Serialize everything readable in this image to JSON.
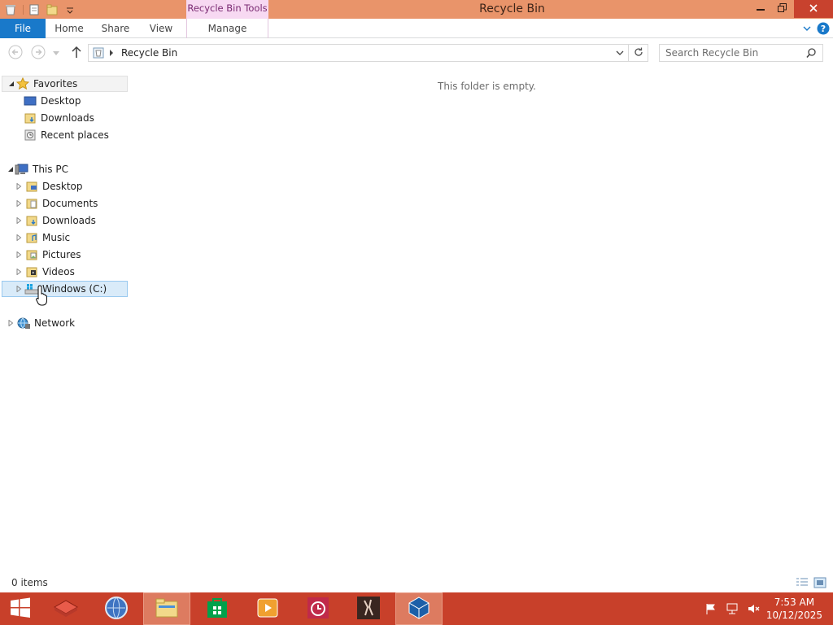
{
  "window": {
    "title": "Recycle Bin",
    "context_tab_group": "Recycle Bin Tools"
  },
  "ribbon": {
    "tabs": [
      "File",
      "Home",
      "Share",
      "View",
      "Manage"
    ]
  },
  "address": {
    "path": "Recycle Bin"
  },
  "search": {
    "placeholder": "Search Recycle Bin"
  },
  "nav": {
    "favorites": {
      "label": "Favorites",
      "items": [
        "Desktop",
        "Downloads",
        "Recent places"
      ]
    },
    "this_pc": {
      "label": "This PC",
      "items": [
        "Desktop",
        "Documents",
        "Downloads",
        "Music",
        "Pictures",
        "Videos",
        "Windows (C:)"
      ]
    },
    "network": {
      "label": "Network"
    }
  },
  "content": {
    "empty_message": "This folder is empty."
  },
  "status": {
    "item_count": "0 items"
  },
  "taskbar": {
    "apps": [
      "start-icon",
      "app-red-box-icon",
      "browser-globe-icon",
      "file-explorer-icon",
      "store-icon",
      "video-player-icon",
      "alarm-clock-icon",
      "game-icon",
      "virtualbox-icon"
    ],
    "time": "7:53 AM",
    "date": "10/12/2025"
  },
  "colors": {
    "titlebar": "#e9946a",
    "taskbar": "#c8402a",
    "file_tab": "#1979ca",
    "context_tab": "#f7d9f2",
    "selection": "#d9ebf9"
  }
}
